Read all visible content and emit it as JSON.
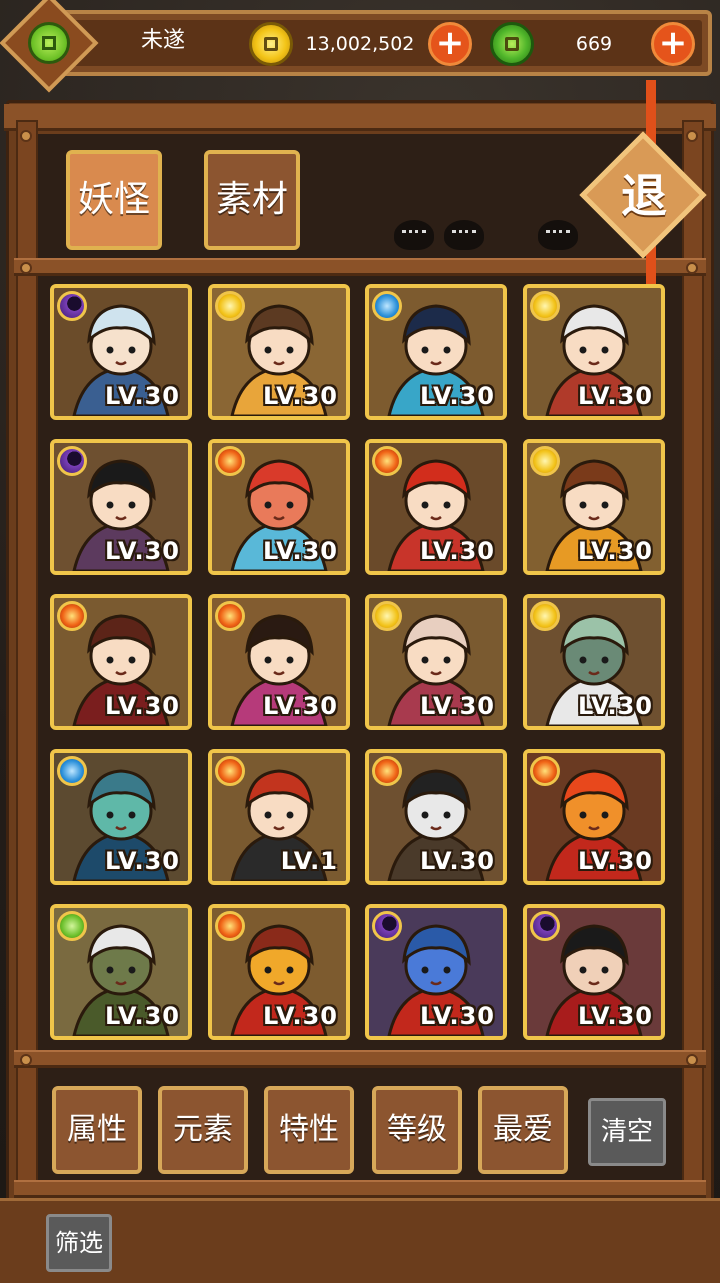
{
  "header": {
    "player_name": "未遂",
    "gold_amount": "13,002,502",
    "jade_amount": "669",
    "add_label": "+"
  },
  "tabs": {
    "yokai_label": "妖怪",
    "material_label": "素材"
  },
  "exit_label": "退",
  "yokai": [
    {
      "level": "LV.30",
      "element": "dark",
      "hair": "#cfe3ee",
      "skin": "#f6e1cc",
      "cloth": "#3a5f91",
      "bg": "#6b4c2a"
    },
    {
      "level": "LV.30",
      "element": "light",
      "hair": "#5c3a22",
      "skin": "#f8dcc3",
      "cloth": "#e8a53a",
      "bg": "#8a6634"
    },
    {
      "level": "LV.30",
      "element": "water",
      "hair": "#1c2b4a",
      "skin": "#f8dcc3",
      "cloth": "#38a6c8",
      "bg": "#7d5b2f"
    },
    {
      "level": "LV.30",
      "element": "light",
      "hair": "#e8e8e8",
      "skin": "#f8dcc3",
      "cloth": "#b03a2a",
      "bg": "#7a5a30"
    },
    {
      "level": "LV.30",
      "element": "dark",
      "hair": "#1a1a1a",
      "skin": "#f8dcc3",
      "cloth": "#5c3a5e",
      "bg": "#6e5030"
    },
    {
      "level": "LV.30",
      "element": "fire",
      "hair": "#d93a2a",
      "skin": "#e97a5a",
      "cloth": "#59b8d8",
      "bg": "#7d5b2f"
    },
    {
      "level": "LV.30",
      "element": "fire",
      "hair": "#d22d1c",
      "skin": "#f8dcc3",
      "cloth": "#c8342a",
      "bg": "#6a4a2a"
    },
    {
      "level": "LV.30",
      "element": "light",
      "hair": "#7a3a1a",
      "skin": "#f8dcc3",
      "cloth": "#e79a24",
      "bg": "#826030"
    },
    {
      "level": "LV.30",
      "element": "fire",
      "hair": "#5c2418",
      "skin": "#f8dcc3",
      "cloth": "#7a1e1e",
      "bg": "#7a5a30"
    },
    {
      "level": "LV.30",
      "element": "fire",
      "hair": "#2a1a12",
      "skin": "#f8dcc3",
      "cloth": "#b63a7a",
      "bg": "#825c30"
    },
    {
      "level": "LV.30",
      "element": "light",
      "hair": "#e8cfc0",
      "skin": "#f8dcc3",
      "cloth": "#a83a4e",
      "bg": "#7a5a30"
    },
    {
      "level": "LV.30",
      "element": "light",
      "hair": "#9bc2a8",
      "skin": "#6a8a76",
      "cloth": "#e8e8e8",
      "bg": "#6e5030"
    },
    {
      "level": "LV.30",
      "element": "water",
      "hair": "#3a7a8a",
      "skin": "#5fb8a8",
      "cloth": "#1d4a6a",
      "bg": "#5c4a30"
    },
    {
      "level": "LV.1",
      "element": "fire",
      "hair": "#c2341e",
      "skin": "#f8dcc3",
      "cloth": "#2a2a2a",
      "bg": "#7a5a30"
    },
    {
      "level": "LV.30",
      "element": "fire",
      "hair": "#222222",
      "skin": "#e8e8e8",
      "cloth": "#4a3a2a",
      "bg": "#6e5030"
    },
    {
      "level": "LV.30",
      "element": "fire",
      "hair": "#e8481c",
      "skin": "#f0902a",
      "cloth": "#c2281c",
      "bg": "#6a3a22"
    },
    {
      "level": "LV.30",
      "element": "wood",
      "hair": "#e8e8e8",
      "skin": "#6e7a4a",
      "cloth": "#4a5a2a",
      "bg": "#7a6a40"
    },
    {
      "level": "LV.30",
      "element": "fire",
      "hair": "#8a2a1a",
      "skin": "#f0a82a",
      "cloth": "#c2281c",
      "bg": "#7d5b2f"
    },
    {
      "level": "LV.30",
      "element": "dark",
      "hair": "#2a5aa8",
      "skin": "#4a7ad8",
      "cloth": "#c2281c",
      "bg": "#4a3a5a"
    },
    {
      "level": "LV.30",
      "element": "dark",
      "hair": "#1a1a1a",
      "skin": "#f0d0b8",
      "cloth": "#a81c1c",
      "bg": "#6a3a3a"
    }
  ],
  "filters": {
    "attribute_label": "属性",
    "element_label": "元素",
    "trait_label": "特性",
    "level_label": "等级",
    "favorite_label": "最爱",
    "clear_label": "清空",
    "filter_label": "筛选"
  }
}
